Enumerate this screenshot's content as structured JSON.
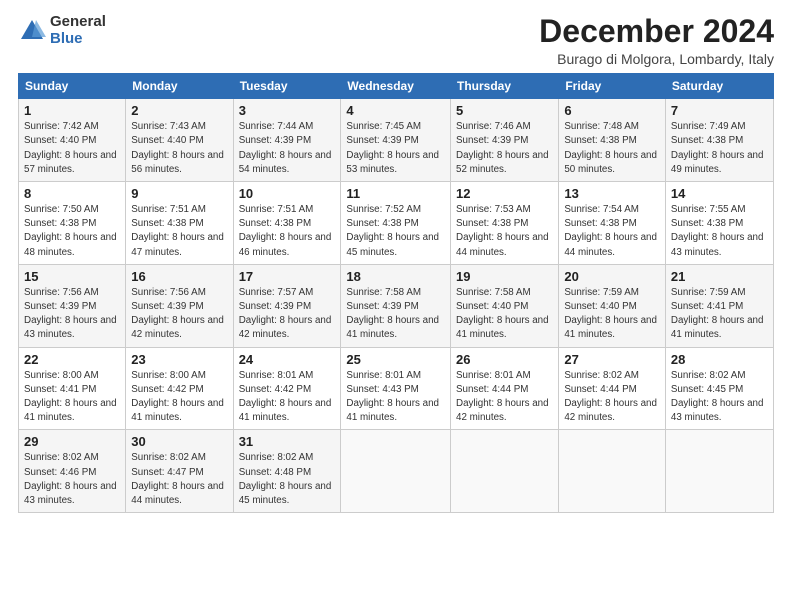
{
  "logo": {
    "general": "General",
    "blue": "Blue"
  },
  "header": {
    "title": "December 2024",
    "subtitle": "Burago di Molgora, Lombardy, Italy"
  },
  "columns": [
    "Sunday",
    "Monday",
    "Tuesday",
    "Wednesday",
    "Thursday",
    "Friday",
    "Saturday"
  ],
  "weeks": [
    [
      {
        "day": "1",
        "sunrise": "Sunrise: 7:42 AM",
        "sunset": "Sunset: 4:40 PM",
        "daylight": "Daylight: 8 hours and 57 minutes."
      },
      {
        "day": "2",
        "sunrise": "Sunrise: 7:43 AM",
        "sunset": "Sunset: 4:40 PM",
        "daylight": "Daylight: 8 hours and 56 minutes."
      },
      {
        "day": "3",
        "sunrise": "Sunrise: 7:44 AM",
        "sunset": "Sunset: 4:39 PM",
        "daylight": "Daylight: 8 hours and 54 minutes."
      },
      {
        "day": "4",
        "sunrise": "Sunrise: 7:45 AM",
        "sunset": "Sunset: 4:39 PM",
        "daylight": "Daylight: 8 hours and 53 minutes."
      },
      {
        "day": "5",
        "sunrise": "Sunrise: 7:46 AM",
        "sunset": "Sunset: 4:39 PM",
        "daylight": "Daylight: 8 hours and 52 minutes."
      },
      {
        "day": "6",
        "sunrise": "Sunrise: 7:48 AM",
        "sunset": "Sunset: 4:38 PM",
        "daylight": "Daylight: 8 hours and 50 minutes."
      },
      {
        "day": "7",
        "sunrise": "Sunrise: 7:49 AM",
        "sunset": "Sunset: 4:38 PM",
        "daylight": "Daylight: 8 hours and 49 minutes."
      }
    ],
    [
      {
        "day": "8",
        "sunrise": "Sunrise: 7:50 AM",
        "sunset": "Sunset: 4:38 PM",
        "daylight": "Daylight: 8 hours and 48 minutes."
      },
      {
        "day": "9",
        "sunrise": "Sunrise: 7:51 AM",
        "sunset": "Sunset: 4:38 PM",
        "daylight": "Daylight: 8 hours and 47 minutes."
      },
      {
        "day": "10",
        "sunrise": "Sunrise: 7:51 AM",
        "sunset": "Sunset: 4:38 PM",
        "daylight": "Daylight: 8 hours and 46 minutes."
      },
      {
        "day": "11",
        "sunrise": "Sunrise: 7:52 AM",
        "sunset": "Sunset: 4:38 PM",
        "daylight": "Daylight: 8 hours and 45 minutes."
      },
      {
        "day": "12",
        "sunrise": "Sunrise: 7:53 AM",
        "sunset": "Sunset: 4:38 PM",
        "daylight": "Daylight: 8 hours and 44 minutes."
      },
      {
        "day": "13",
        "sunrise": "Sunrise: 7:54 AM",
        "sunset": "Sunset: 4:38 PM",
        "daylight": "Daylight: 8 hours and 44 minutes."
      },
      {
        "day": "14",
        "sunrise": "Sunrise: 7:55 AM",
        "sunset": "Sunset: 4:38 PM",
        "daylight": "Daylight: 8 hours and 43 minutes."
      }
    ],
    [
      {
        "day": "15",
        "sunrise": "Sunrise: 7:56 AM",
        "sunset": "Sunset: 4:39 PM",
        "daylight": "Daylight: 8 hours and 43 minutes."
      },
      {
        "day": "16",
        "sunrise": "Sunrise: 7:56 AM",
        "sunset": "Sunset: 4:39 PM",
        "daylight": "Daylight: 8 hours and 42 minutes."
      },
      {
        "day": "17",
        "sunrise": "Sunrise: 7:57 AM",
        "sunset": "Sunset: 4:39 PM",
        "daylight": "Daylight: 8 hours and 42 minutes."
      },
      {
        "day": "18",
        "sunrise": "Sunrise: 7:58 AM",
        "sunset": "Sunset: 4:39 PM",
        "daylight": "Daylight: 8 hours and 41 minutes."
      },
      {
        "day": "19",
        "sunrise": "Sunrise: 7:58 AM",
        "sunset": "Sunset: 4:40 PM",
        "daylight": "Daylight: 8 hours and 41 minutes."
      },
      {
        "day": "20",
        "sunrise": "Sunrise: 7:59 AM",
        "sunset": "Sunset: 4:40 PM",
        "daylight": "Daylight: 8 hours and 41 minutes."
      },
      {
        "day": "21",
        "sunrise": "Sunrise: 7:59 AM",
        "sunset": "Sunset: 4:41 PM",
        "daylight": "Daylight: 8 hours and 41 minutes."
      }
    ],
    [
      {
        "day": "22",
        "sunrise": "Sunrise: 8:00 AM",
        "sunset": "Sunset: 4:41 PM",
        "daylight": "Daylight: 8 hours and 41 minutes."
      },
      {
        "day": "23",
        "sunrise": "Sunrise: 8:00 AM",
        "sunset": "Sunset: 4:42 PM",
        "daylight": "Daylight: 8 hours and 41 minutes."
      },
      {
        "day": "24",
        "sunrise": "Sunrise: 8:01 AM",
        "sunset": "Sunset: 4:42 PM",
        "daylight": "Daylight: 8 hours and 41 minutes."
      },
      {
        "day": "25",
        "sunrise": "Sunrise: 8:01 AM",
        "sunset": "Sunset: 4:43 PM",
        "daylight": "Daylight: 8 hours and 41 minutes."
      },
      {
        "day": "26",
        "sunrise": "Sunrise: 8:01 AM",
        "sunset": "Sunset: 4:44 PM",
        "daylight": "Daylight: 8 hours and 42 minutes."
      },
      {
        "day": "27",
        "sunrise": "Sunrise: 8:02 AM",
        "sunset": "Sunset: 4:44 PM",
        "daylight": "Daylight: 8 hours and 42 minutes."
      },
      {
        "day": "28",
        "sunrise": "Sunrise: 8:02 AM",
        "sunset": "Sunset: 4:45 PM",
        "daylight": "Daylight: 8 hours and 43 minutes."
      }
    ],
    [
      {
        "day": "29",
        "sunrise": "Sunrise: 8:02 AM",
        "sunset": "Sunset: 4:46 PM",
        "daylight": "Daylight: 8 hours and 43 minutes."
      },
      {
        "day": "30",
        "sunrise": "Sunrise: 8:02 AM",
        "sunset": "Sunset: 4:47 PM",
        "daylight": "Daylight: 8 hours and 44 minutes."
      },
      {
        "day": "31",
        "sunrise": "Sunrise: 8:02 AM",
        "sunset": "Sunset: 4:48 PM",
        "daylight": "Daylight: 8 hours and 45 minutes."
      },
      null,
      null,
      null,
      null
    ]
  ]
}
